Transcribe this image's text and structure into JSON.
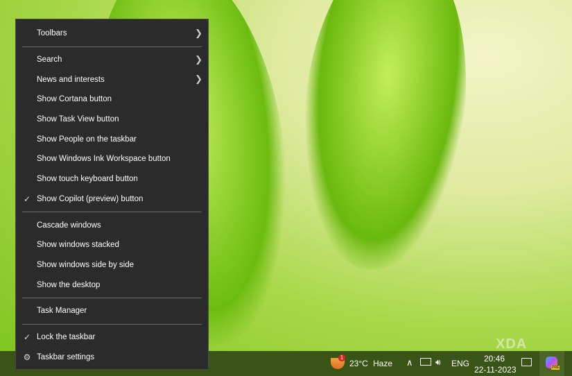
{
  "menu": {
    "items": [
      {
        "label": "Toolbars",
        "submenu": true
      },
      {
        "label": "Search",
        "submenu": true
      },
      {
        "label": "News and interests",
        "submenu": true
      },
      {
        "label": "Show Cortana button"
      },
      {
        "label": "Show Task View button"
      },
      {
        "label": "Show People on the taskbar"
      },
      {
        "label": "Show Windows Ink Workspace button"
      },
      {
        "label": "Show touch keyboard button"
      },
      {
        "label": "Show Copilot (preview) button",
        "checked": true
      },
      {
        "label": "Cascade windows"
      },
      {
        "label": "Show windows stacked"
      },
      {
        "label": "Show windows side by side"
      },
      {
        "label": "Show the desktop"
      },
      {
        "label": "Task Manager"
      },
      {
        "label": "Lock the taskbar",
        "checked": true
      },
      {
        "label": "Taskbar settings",
        "icon": "gear-icon"
      }
    ]
  },
  "taskbar": {
    "weather_badge": "1",
    "temperature": "23°C",
    "condition": "Haze",
    "language": "ENG",
    "time": "20:46",
    "date": "22-11-2023",
    "copilot_badge": "PRE"
  },
  "watermark": "XDA"
}
